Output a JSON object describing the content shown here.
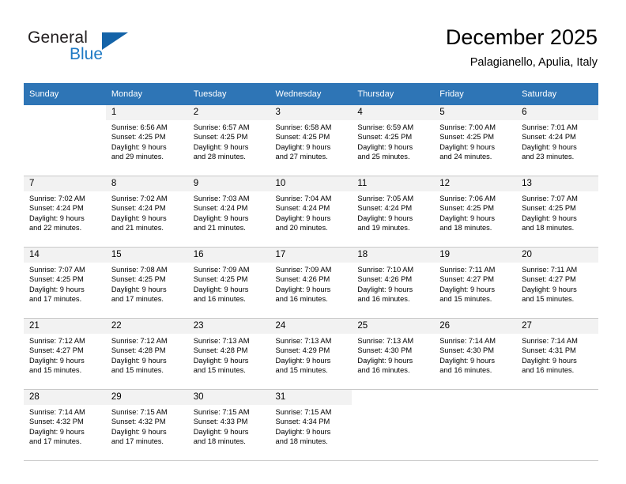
{
  "brand": {
    "name_primary": "General",
    "name_secondary": "Blue",
    "logo_icon": "blue-triangle-flag-icon"
  },
  "header": {
    "title": "December 2025",
    "subtitle": "Palagianello, Apulia, Italy"
  },
  "colors": {
    "header_row_bg": "#2e75b6",
    "daynum_bg": "#f2f2f2",
    "brand_blue": "#1f7ac4",
    "logo_blue": "#1463a8",
    "grid_line": "#c9c9c9"
  },
  "weekday_headers": [
    "Sunday",
    "Monday",
    "Tuesday",
    "Wednesday",
    "Thursday",
    "Friday",
    "Saturday"
  ],
  "weeks": [
    [
      {
        "day": "",
        "lines": []
      },
      {
        "day": "1",
        "lines": [
          "Sunrise: 6:56 AM",
          "Sunset: 4:25 PM",
          "Daylight: 9 hours",
          "and 29 minutes."
        ]
      },
      {
        "day": "2",
        "lines": [
          "Sunrise: 6:57 AM",
          "Sunset: 4:25 PM",
          "Daylight: 9 hours",
          "and 28 minutes."
        ]
      },
      {
        "day": "3",
        "lines": [
          "Sunrise: 6:58 AM",
          "Sunset: 4:25 PM",
          "Daylight: 9 hours",
          "and 27 minutes."
        ]
      },
      {
        "day": "4",
        "lines": [
          "Sunrise: 6:59 AM",
          "Sunset: 4:25 PM",
          "Daylight: 9 hours",
          "and 25 minutes."
        ]
      },
      {
        "day": "5",
        "lines": [
          "Sunrise: 7:00 AM",
          "Sunset: 4:25 PM",
          "Daylight: 9 hours",
          "and 24 minutes."
        ]
      },
      {
        "day": "6",
        "lines": [
          "Sunrise: 7:01 AM",
          "Sunset: 4:24 PM",
          "Daylight: 9 hours",
          "and 23 minutes."
        ]
      }
    ],
    [
      {
        "day": "7",
        "lines": [
          "Sunrise: 7:02 AM",
          "Sunset: 4:24 PM",
          "Daylight: 9 hours",
          "and 22 minutes."
        ]
      },
      {
        "day": "8",
        "lines": [
          "Sunrise: 7:02 AM",
          "Sunset: 4:24 PM",
          "Daylight: 9 hours",
          "and 21 minutes."
        ]
      },
      {
        "day": "9",
        "lines": [
          "Sunrise: 7:03 AM",
          "Sunset: 4:24 PM",
          "Daylight: 9 hours",
          "and 21 minutes."
        ]
      },
      {
        "day": "10",
        "lines": [
          "Sunrise: 7:04 AM",
          "Sunset: 4:24 PM",
          "Daylight: 9 hours",
          "and 20 minutes."
        ]
      },
      {
        "day": "11",
        "lines": [
          "Sunrise: 7:05 AM",
          "Sunset: 4:24 PM",
          "Daylight: 9 hours",
          "and 19 minutes."
        ]
      },
      {
        "day": "12",
        "lines": [
          "Sunrise: 7:06 AM",
          "Sunset: 4:25 PM",
          "Daylight: 9 hours",
          "and 18 minutes."
        ]
      },
      {
        "day": "13",
        "lines": [
          "Sunrise: 7:07 AM",
          "Sunset: 4:25 PM",
          "Daylight: 9 hours",
          "and 18 minutes."
        ]
      }
    ],
    [
      {
        "day": "14",
        "lines": [
          "Sunrise: 7:07 AM",
          "Sunset: 4:25 PM",
          "Daylight: 9 hours",
          "and 17 minutes."
        ]
      },
      {
        "day": "15",
        "lines": [
          "Sunrise: 7:08 AM",
          "Sunset: 4:25 PM",
          "Daylight: 9 hours",
          "and 17 minutes."
        ]
      },
      {
        "day": "16",
        "lines": [
          "Sunrise: 7:09 AM",
          "Sunset: 4:25 PM",
          "Daylight: 9 hours",
          "and 16 minutes."
        ]
      },
      {
        "day": "17",
        "lines": [
          "Sunrise: 7:09 AM",
          "Sunset: 4:26 PM",
          "Daylight: 9 hours",
          "and 16 minutes."
        ]
      },
      {
        "day": "18",
        "lines": [
          "Sunrise: 7:10 AM",
          "Sunset: 4:26 PM",
          "Daylight: 9 hours",
          "and 16 minutes."
        ]
      },
      {
        "day": "19",
        "lines": [
          "Sunrise: 7:11 AM",
          "Sunset: 4:27 PM",
          "Daylight: 9 hours",
          "and 15 minutes."
        ]
      },
      {
        "day": "20",
        "lines": [
          "Sunrise: 7:11 AM",
          "Sunset: 4:27 PM",
          "Daylight: 9 hours",
          "and 15 minutes."
        ]
      }
    ],
    [
      {
        "day": "21",
        "lines": [
          "Sunrise: 7:12 AM",
          "Sunset: 4:27 PM",
          "Daylight: 9 hours",
          "and 15 minutes."
        ]
      },
      {
        "day": "22",
        "lines": [
          "Sunrise: 7:12 AM",
          "Sunset: 4:28 PM",
          "Daylight: 9 hours",
          "and 15 minutes."
        ]
      },
      {
        "day": "23",
        "lines": [
          "Sunrise: 7:13 AM",
          "Sunset: 4:28 PM",
          "Daylight: 9 hours",
          "and 15 minutes."
        ]
      },
      {
        "day": "24",
        "lines": [
          "Sunrise: 7:13 AM",
          "Sunset: 4:29 PM",
          "Daylight: 9 hours",
          "and 15 minutes."
        ]
      },
      {
        "day": "25",
        "lines": [
          "Sunrise: 7:13 AM",
          "Sunset: 4:30 PM",
          "Daylight: 9 hours",
          "and 16 minutes."
        ]
      },
      {
        "day": "26",
        "lines": [
          "Sunrise: 7:14 AM",
          "Sunset: 4:30 PM",
          "Daylight: 9 hours",
          "and 16 minutes."
        ]
      },
      {
        "day": "27",
        "lines": [
          "Sunrise: 7:14 AM",
          "Sunset: 4:31 PM",
          "Daylight: 9 hours",
          "and 16 minutes."
        ]
      }
    ],
    [
      {
        "day": "28",
        "lines": [
          "Sunrise: 7:14 AM",
          "Sunset: 4:32 PM",
          "Daylight: 9 hours",
          "and 17 minutes."
        ]
      },
      {
        "day": "29",
        "lines": [
          "Sunrise: 7:15 AM",
          "Sunset: 4:32 PM",
          "Daylight: 9 hours",
          "and 17 minutes."
        ]
      },
      {
        "day": "30",
        "lines": [
          "Sunrise: 7:15 AM",
          "Sunset: 4:33 PM",
          "Daylight: 9 hours",
          "and 18 minutes."
        ]
      },
      {
        "day": "31",
        "lines": [
          "Sunrise: 7:15 AM",
          "Sunset: 4:34 PM",
          "Daylight: 9 hours",
          "and 18 minutes."
        ]
      },
      {
        "day": "",
        "lines": []
      },
      {
        "day": "",
        "lines": []
      },
      {
        "day": "",
        "lines": []
      }
    ]
  ]
}
